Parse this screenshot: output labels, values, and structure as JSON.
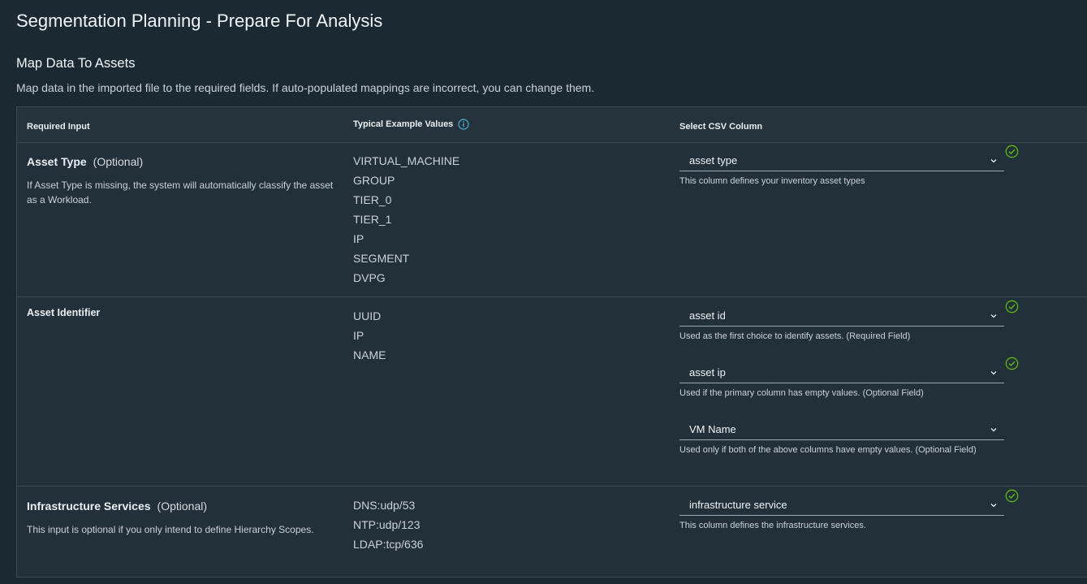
{
  "page": {
    "title": "Segmentation Planning - Prepare For Analysis",
    "section_title": "Map Data To Assets",
    "section_desc": "Map data in the imported file to the required fields. If auto-populated mappings are incorrect, you can change them."
  },
  "table": {
    "headers": {
      "required_input": "Required Input",
      "example_values": "Typical Example Values",
      "csv_column": "Select CSV Column"
    },
    "rows": [
      {
        "title": "Asset Type",
        "optional": "(Optional)",
        "desc": "If Asset Type is missing, the system will automatically classify the asset as a Workload.",
        "examples": [
          "VIRTUAL_MACHINE",
          "GROUP",
          "TIER_0",
          "TIER_1",
          "IP",
          "SEGMENT",
          "DVPG"
        ],
        "selects": [
          {
            "value": "asset type",
            "helper": "This column defines your inventory asset types",
            "valid": true
          }
        ]
      },
      {
        "title": "Asset Identifier",
        "optional": "",
        "desc": "",
        "examples": [
          "UUID",
          "IP",
          "NAME"
        ],
        "selects": [
          {
            "value": "asset id",
            "helper": "Used as the first choice to identify assets. (Required Field)",
            "valid": true
          },
          {
            "value": "asset ip",
            "helper": "Used if the primary column has empty values. (Optional Field)",
            "valid": true
          },
          {
            "value": "VM Name",
            "helper": "Used only if both of the above columns have empty values. (Optional Field)",
            "valid": false
          }
        ]
      },
      {
        "title": "Infrastructure Services",
        "optional": "(Optional)",
        "desc": "This input is optional if you only intend to define Hierarchy Scopes.",
        "examples": [
          "DNS:udp/53",
          "NTP:udp/123",
          "LDAP:tcp/636"
        ],
        "selects": [
          {
            "value": "infrastructure service",
            "helper": "This column defines the infrastructure services.",
            "valid": true
          }
        ]
      }
    ]
  },
  "colors": {
    "background": "#1b2a32",
    "accent_info": "#49afd9",
    "success": "#5eb715"
  },
  "icons": {
    "info": "info-circle-icon",
    "chevron": "chevron-down-icon",
    "check": "success-check-icon"
  }
}
